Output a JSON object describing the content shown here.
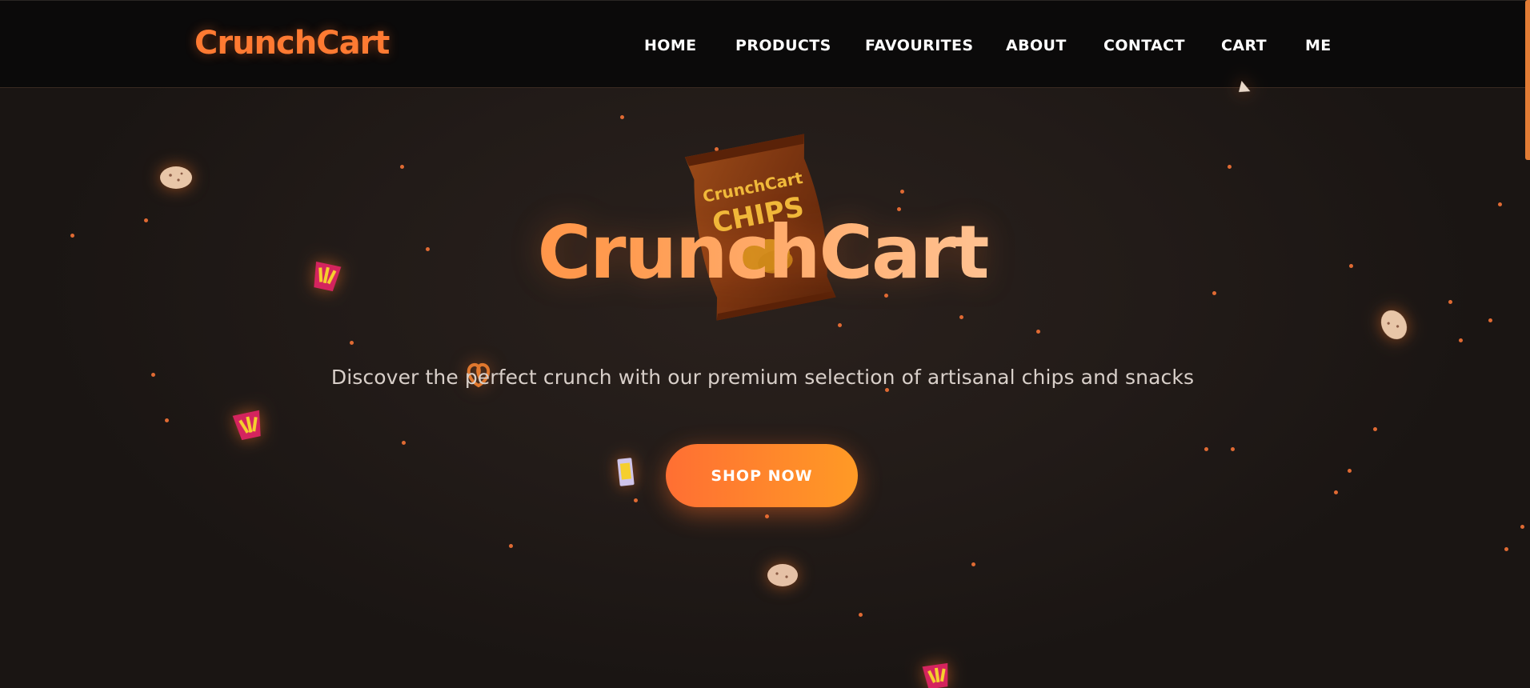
{
  "nav": {
    "brand": "CrunchCart",
    "links": [
      {
        "label": "HOME"
      },
      {
        "label": "PRODUCTS"
      },
      {
        "label": "FAVOURITES"
      },
      {
        "label": "ABOUT"
      },
      {
        "label": "CONTACT"
      },
      {
        "label": "CART"
      },
      {
        "label": "ME"
      }
    ]
  },
  "hero": {
    "title": "CrunchCart",
    "subtitle": "Discover the perfect crunch with our premium selection of artisanal chips and snacks",
    "cta_label": "SHOP NOW",
    "bag_brand": "CrunchCart",
    "bag_product": "CHIPS"
  },
  "colors": {
    "accent": "#ff7a32",
    "accent_end": "#ff9a25",
    "nav_bg": "#0b0a0a",
    "page_bg": "#1c1614",
    "particle": "#e06a33"
  },
  "icons": {
    "floating_snacks": [
      "potato-icon",
      "fries-icon",
      "pretzel-icon",
      "chip-icon",
      "chip-bag-icon"
    ]
  }
}
